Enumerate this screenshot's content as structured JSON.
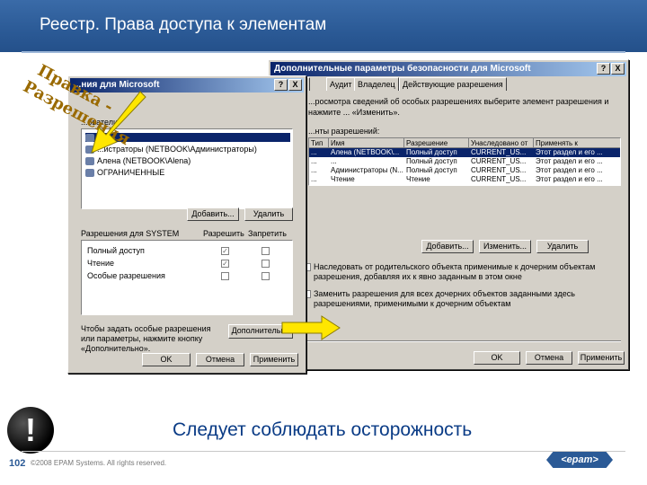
{
  "header": {
    "title": "Реестр. Права доступа к элементам"
  },
  "callout": {
    "lines": [
      "Правка -",
      "Разрешения"
    ]
  },
  "left_dialog": {
    "title": "...ния для Microsoft",
    "title_help": "?",
    "title_close": "X",
    "groups_label": "...ователи:",
    "users": [
      "",
      "...истраторы (NETBOOK\\Администраторы)",
      "Алена (NETBOOK\\Alena)",
      "ОГРАНИЧЕННЫЕ"
    ],
    "add_button": "Добавить...",
    "remove_button": "Удалить",
    "perm_header": "Разрешения для SYSTEM",
    "allow_header": "Разрешить",
    "deny_header": "Запретить",
    "permissions": [
      "Полный доступ",
      "Чтение",
      "Особые разрешения"
    ],
    "hint_text": "Чтобы задать особые разрешения или параметры, нажмите кнопку «Дополнительно».",
    "advanced_button": "Дополнительно",
    "ok": "OK",
    "cancel": "Отмена",
    "apply": "Применить"
  },
  "right_dialog": {
    "title": "Дополнительные параметры безопасности для Microsoft",
    "title_help": "?",
    "title_close": "X",
    "tabs": [
      "...",
      "Аудит",
      "Владелец",
      "Действующие разрешения"
    ],
    "description": "...росмотра сведений об особых разрешениях выберите элемент разрешения и нажмите ... «Изменить».",
    "entries_label": "...нты разрешений:",
    "columns": [
      "Тип",
      "Имя",
      "Разрешение",
      "Унаследовано от",
      "Применять к"
    ],
    "rows": [
      [
        "...",
        "Алена (NETBOOK\\...",
        "Полный доступ",
        "CURRENT_US...",
        "Этот раздел и его ..."
      ],
      [
        "...",
        "...",
        "Полный доступ",
        "CURRENT_US...",
        "Этот раздел и его ..."
      ],
      [
        "...",
        "Администраторы (N...",
        "Полный доступ",
        "CURRENT_US...",
        "Этот раздел и его ..."
      ],
      [
        "...",
        "Чтение",
        "Чтение",
        "CURRENT_US...",
        "Этот раздел и его ..."
      ]
    ],
    "add_button": "Добавить...",
    "edit_button": "Изменить...",
    "remove_button": "Удалить",
    "inherit_text": "Наследовать от родительского объекта применимые к дочерним объектам разрешения, добавляя их к явно заданным в этом окне",
    "replace_text": "Заменить разрешения для всех дочерних объектов заданными здесь разрешениями, применимыми к дочерним объектам",
    "ok": "OK",
    "cancel": "Отмена",
    "apply": "Применить"
  },
  "caution_text": "Следует соблюдать осторожность",
  "exclamation": "!",
  "footer": {
    "page_number": "102",
    "copyright": "©2008 EPAM Systems. All rights reserved.",
    "logo": "<epam>"
  }
}
